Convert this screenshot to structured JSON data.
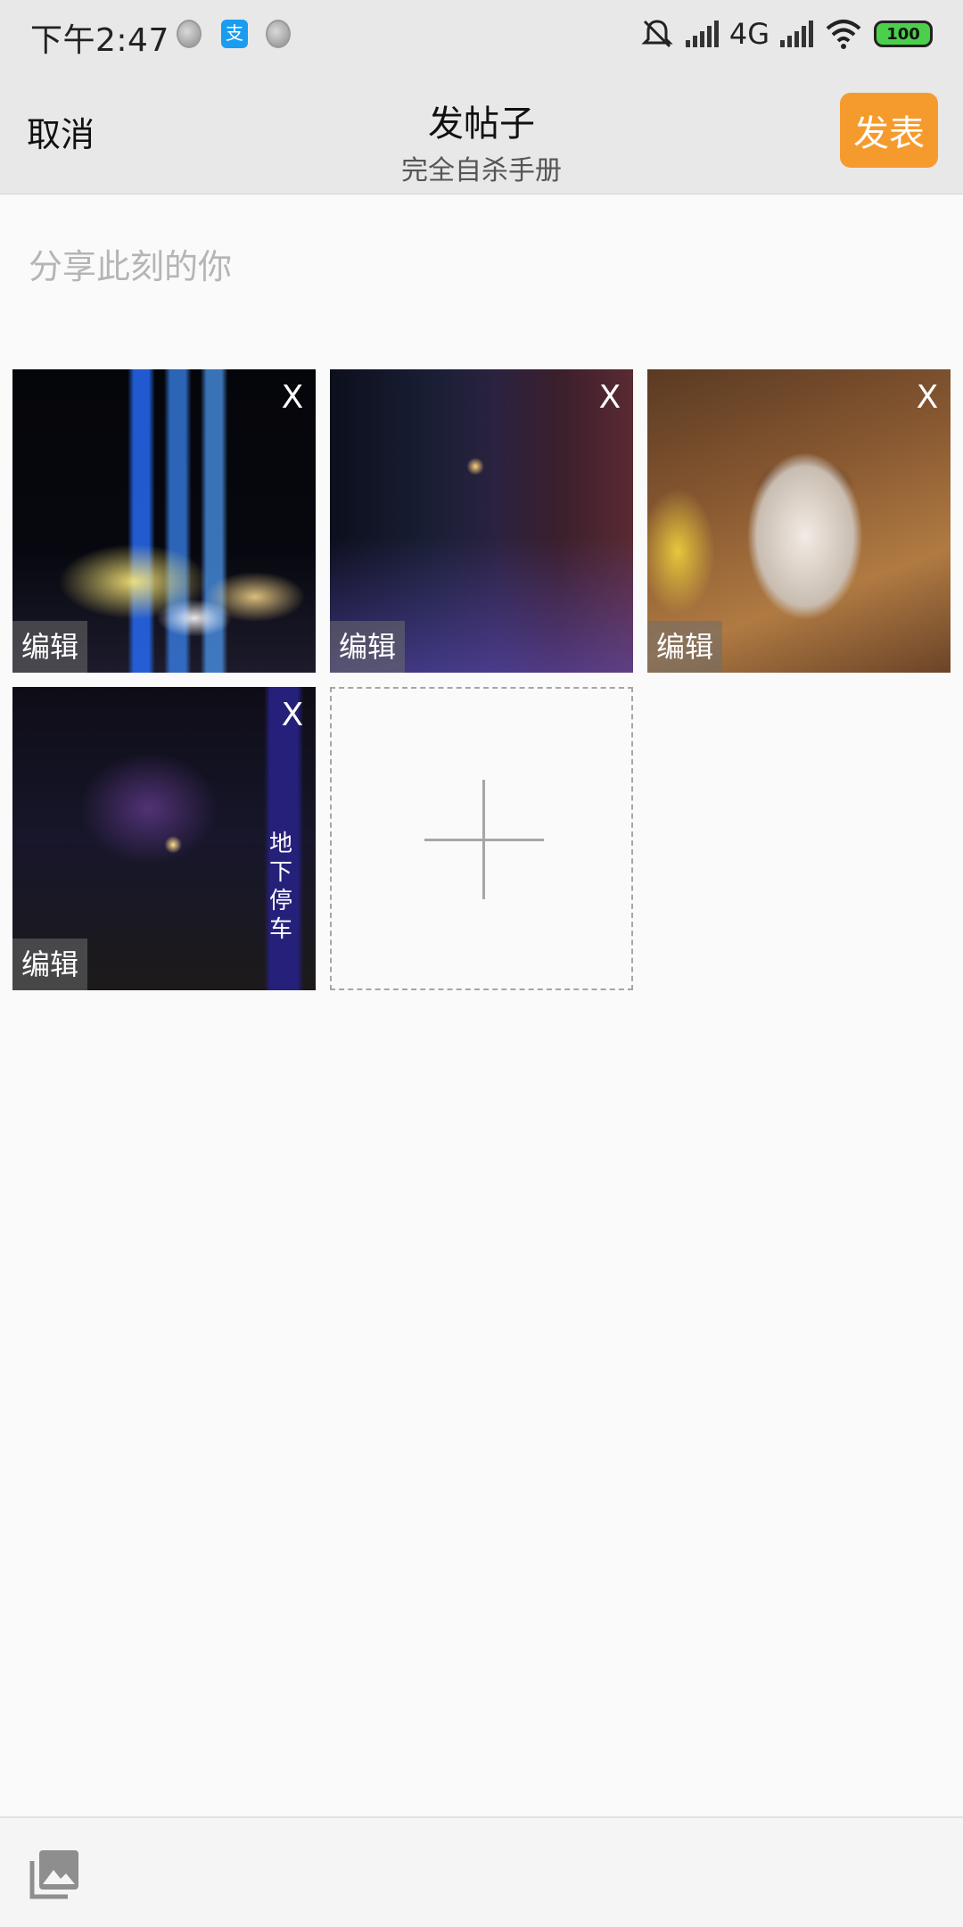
{
  "status_bar": {
    "time": "下午2:47",
    "alipay_glyph": "支",
    "network": "4G",
    "battery": "100",
    "icons": [
      "notification-dot",
      "alipay-icon",
      "notification-dot",
      "mute-icon",
      "signal-icon",
      "signal-icon",
      "wifi-icon",
      "battery-icon"
    ]
  },
  "header": {
    "cancel_label": "取消",
    "title": "发帖子",
    "subtitle": "完全自杀手册",
    "publish_label": "发表",
    "publish_color": "#f59b2e"
  },
  "composer": {
    "placeholder": "分享此刻的你",
    "value": ""
  },
  "photos": [
    {
      "edit_label": "编辑",
      "close_label": "X"
    },
    {
      "edit_label": "编辑",
      "close_label": "X"
    },
    {
      "edit_label": "编辑",
      "close_label": "X"
    },
    {
      "edit_label": "编辑",
      "close_label": "X",
      "sign_text": "地下停车"
    }
  ],
  "add_photo": {
    "icon": "plus-icon"
  },
  "bottom_bar": {
    "icon": "gallery-icon"
  }
}
